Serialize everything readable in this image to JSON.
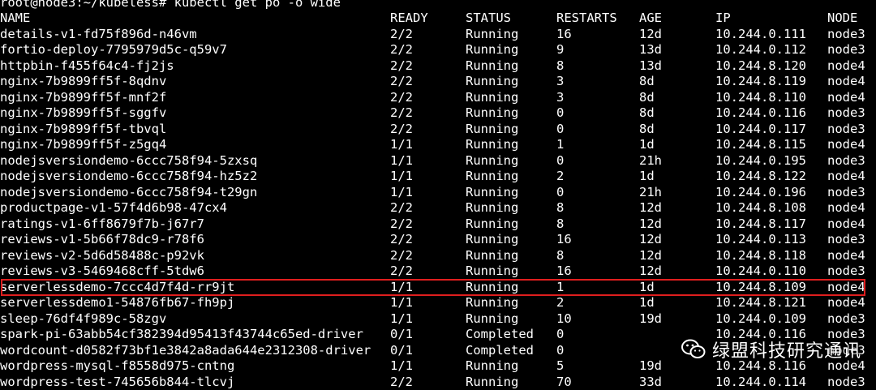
{
  "terminal": {
    "prompt": "root@node3:~/kubeless# kubectl get po -o wide",
    "headers": [
      "NAME",
      "READY",
      "STATUS",
      "RESTARTS",
      "AGE",
      "IP",
      "NODE"
    ],
    "rows": [
      [
        "details-v1-fd75f896d-n46vm",
        "2/2",
        "Running",
        "16",
        "12d",
        "10.244.0.111",
        "node3"
      ],
      [
        "fortio-deploy-7795979d5c-q59v7",
        "2/2",
        "Running",
        "9",
        "13d",
        "10.244.0.112",
        "node3"
      ],
      [
        "httpbin-f455f64c4-fj2js",
        "2/2",
        "Running",
        "8",
        "13d",
        "10.244.8.120",
        "node4"
      ],
      [
        "nginx-7b9899ff5f-8qdnv",
        "2/2",
        "Running",
        "3",
        "8d",
        "10.244.8.119",
        "node4"
      ],
      [
        "nginx-7b9899ff5f-mnf2f",
        "2/2",
        "Running",
        "3",
        "8d",
        "10.244.8.110",
        "node4"
      ],
      [
        "nginx-7b9899ff5f-sggfv",
        "2/2",
        "Running",
        "0",
        "8d",
        "10.244.0.116",
        "node3"
      ],
      [
        "nginx-7b9899ff5f-tbvql",
        "2/2",
        "Running",
        "0",
        "8d",
        "10.244.0.117",
        "node3"
      ],
      [
        "nginx-7b9899ff5f-z5gq4",
        "1/1",
        "Running",
        "1",
        "1d",
        "10.244.8.115",
        "node4"
      ],
      [
        "nodejsversiondemo-6ccc758f94-5zxsq",
        "1/1",
        "Running",
        "0",
        "21h",
        "10.244.0.195",
        "node3"
      ],
      [
        "nodejsversiondemo-6ccc758f94-hz5z2",
        "1/1",
        "Running",
        "2",
        "1d",
        "10.244.8.122",
        "node4"
      ],
      [
        "nodejsversiondemo-6ccc758f94-t29gn",
        "1/1",
        "Running",
        "0",
        "21h",
        "10.244.0.196",
        "node3"
      ],
      [
        "productpage-v1-57f4d6b98-47cx4",
        "2/2",
        "Running",
        "8",
        "12d",
        "10.244.8.108",
        "node4"
      ],
      [
        "ratings-v1-6ff8679f7b-j67r7",
        "2/2",
        "Running",
        "8",
        "12d",
        "10.244.8.117",
        "node4"
      ],
      [
        "reviews-v1-5b66f78dc9-r78f6",
        "2/2",
        "Running",
        "16",
        "12d",
        "10.244.0.113",
        "node3"
      ],
      [
        "reviews-v2-5d6d58488c-p92vk",
        "2/2",
        "Running",
        "8",
        "12d",
        "10.244.8.118",
        "node4"
      ],
      [
        "reviews-v3-5469468cff-5tdw6",
        "2/2",
        "Running",
        "16",
        "12d",
        "10.244.0.110",
        "node3"
      ],
      [
        "serverlessdemo-7ccc4d7f4d-rr9jt",
        "1/1",
        "Running",
        "1",
        "1d",
        "10.244.8.109",
        "node4"
      ],
      [
        "serverlessdemo1-54876fb67-fh9pj",
        "1/1",
        "Running",
        "2",
        "1d",
        "10.244.8.121",
        "node4"
      ],
      [
        "sleep-76df4f989c-58zgv",
        "1/1",
        "Running",
        "10",
        "19d",
        "10.244.0.109",
        "node3"
      ],
      [
        "spark-pi-63abb54cf382394d95413f43744c65ed-driver",
        "0/1",
        "Completed",
        "0",
        "",
        "10.244.0.116",
        "node3"
      ],
      [
        "wordcount-d0582f73bf1e3842a8ada644e2312308-driver",
        "0/1",
        "Completed",
        "0",
        "",
        "",
        "node3"
      ],
      [
        "wordpress-mysql-f8558d975-cntng",
        "1/1",
        "Running",
        "5",
        "19d",
        "10.244.8.116",
        "node4"
      ],
      [
        "wordpress-test-745656b844-tlcvj",
        "2/2",
        "Running",
        "70",
        "33d",
        "10.244.0.114",
        "node3"
      ]
    ],
    "highlighted_row_index": 16,
    "highlight_color": "#e01e1e",
    "text_color": "#ffffff",
    "background_color": "#000000"
  },
  "watermark": {
    "text": "绿盟科技研究通讯",
    "icon": "wechat-icon"
  }
}
